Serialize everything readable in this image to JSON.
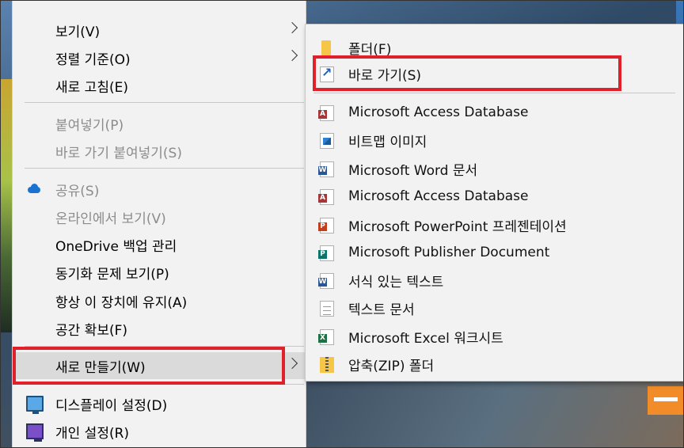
{
  "main_menu": {
    "items": [
      {
        "label": "보기(V)",
        "submenu": true
      },
      {
        "label": "정렬 기준(O)",
        "submenu": true
      },
      {
        "label": "새로 고침(E)"
      },
      {
        "label": "붙여넣기(P)",
        "disabled": true
      },
      {
        "label": "바로 가기 붙여넣기(S)",
        "disabled": true
      },
      {
        "label": "공유(S)",
        "disabled": true,
        "icon": "onedrive-cloud-icon"
      },
      {
        "label": "온라인에서 보기(V)",
        "disabled": true
      },
      {
        "label": "OneDrive 백업 관리"
      },
      {
        "label": "동기화 문제 보기(P)"
      },
      {
        "label": "항상 이 장치에 유지(A)"
      },
      {
        "label": "공간 확보(F)"
      },
      {
        "label": "새로 만들기(W)",
        "submenu": true,
        "highlighted": true
      },
      {
        "label": "디스플레이 설정(D)",
        "icon": "display-settings-icon"
      },
      {
        "label": "개인 설정(R)",
        "icon": "personalize-icon"
      }
    ]
  },
  "sub_menu": {
    "items": [
      {
        "label": "폴더(F)",
        "icon": "folder-icon"
      },
      {
        "label": "바로 가기(S)",
        "icon": "shortcut-icon",
        "highlighted": true
      },
      {
        "label": "Microsoft Access Database",
        "icon": "access-icon"
      },
      {
        "label": "비트맵 이미지",
        "icon": "bitmap-icon"
      },
      {
        "label": "Microsoft Word 문서",
        "icon": "word-icon"
      },
      {
        "label": "Microsoft Access Database",
        "icon": "access-icon"
      },
      {
        "label": "Microsoft PowerPoint 프레젠테이션",
        "icon": "powerpoint-icon"
      },
      {
        "label": "Microsoft Publisher Document",
        "icon": "publisher-icon"
      },
      {
        "label": "서식 있는 텍스트",
        "icon": "rtf-icon"
      },
      {
        "label": "텍스트 문서",
        "icon": "text-document-icon"
      },
      {
        "label": "Microsoft Excel 워크시트",
        "icon": "excel-icon"
      },
      {
        "label": "압축(ZIP) 폴더",
        "icon": "zip-folder-icon"
      }
    ]
  },
  "icon_tags": {
    "access": "A",
    "word": "W",
    "ppt": "P",
    "pub": "P",
    "xls": "X"
  },
  "colors": {
    "highlight_border": "#e0202a",
    "menu_bg": "#f2f2f2",
    "disabled_text": "#8c8c8c"
  }
}
